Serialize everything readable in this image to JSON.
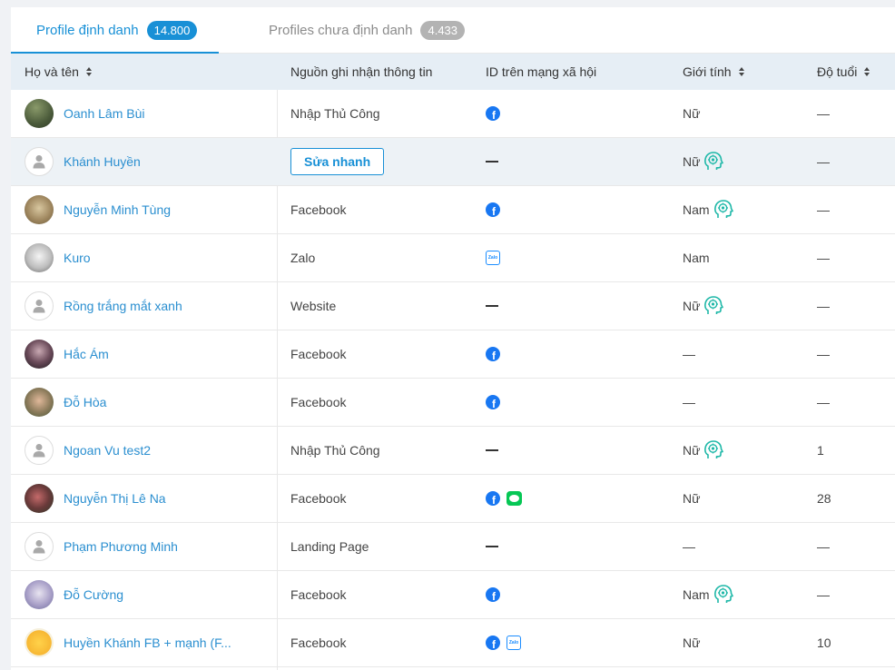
{
  "tabs": {
    "identified": {
      "label": "Profile định danh",
      "count": "14.800"
    },
    "unidentified": {
      "label": "Profiles chưa định danh",
      "count": "4.433"
    }
  },
  "columns": {
    "name": "Họ và tên",
    "source": "Nguồn ghi nhận thông tin",
    "social_id": "ID trên mạng xã hội",
    "gender": "Giới tính",
    "age": "Độ tuổi"
  },
  "actions": {
    "quick_edit": "Sửa nhanh"
  },
  "colors": {
    "accent": "#1890d6",
    "ai_icon": "#1fb8a8",
    "facebook": "#1877f2",
    "zalo": "#1a8cff",
    "line": "#06c755"
  },
  "rows": [
    {
      "name": "Oanh Lâm Bùi",
      "avatar": "photo-forest",
      "source": "Nhập Thủ Công",
      "social": [
        "facebook"
      ],
      "gender": "Nữ",
      "gender_ai": false,
      "age": "—"
    },
    {
      "name": "Khánh Huyền",
      "avatar": "default-user",
      "source": "",
      "quick_edit": true,
      "social": [],
      "gender": "Nữ",
      "gender_ai": true,
      "age": "—"
    },
    {
      "name": "Nguyễn Minh Tùng",
      "avatar": "photo-cat",
      "source": "Facebook",
      "social": [
        "facebook"
      ],
      "gender": "Nam",
      "gender_ai": true,
      "age": "—"
    },
    {
      "name": "Kuro",
      "avatar": "photo-sketch",
      "source": "Zalo",
      "social": [
        "zalo"
      ],
      "gender": "Nam",
      "gender_ai": false,
      "age": "—"
    },
    {
      "name": "Rồng trắng mắt xanh",
      "avatar": "default-user",
      "source": "Website",
      "social": [],
      "gender": "Nữ",
      "gender_ai": true,
      "age": "—"
    },
    {
      "name": "Hắc Ám",
      "avatar": "photo-dark",
      "source": "Facebook",
      "social": [
        "facebook"
      ],
      "gender": "—",
      "gender_ai": false,
      "age": "—"
    },
    {
      "name": "Đỗ Hòa",
      "avatar": "photo-child",
      "source": "Facebook",
      "social": [
        "facebook"
      ],
      "gender": "—",
      "gender_ai": false,
      "age": "—"
    },
    {
      "name": "Ngoan Vu test2",
      "avatar": "default-user",
      "source": "Nhập Thủ Công",
      "social": [],
      "gender": "Nữ",
      "gender_ai": true,
      "age": "1"
    },
    {
      "name": "Nguyễn Thị Lê Na",
      "avatar": "photo-flowers",
      "source": "Facebook",
      "social": [
        "facebook",
        "line"
      ],
      "gender": "Nữ",
      "gender_ai": false,
      "age": "28"
    },
    {
      "name": "Phạm Phương Minh",
      "avatar": "default-user",
      "source": "Landing Page",
      "social": [],
      "gender": "—",
      "gender_ai": false,
      "age": "—"
    },
    {
      "name": "Đỗ Cường",
      "avatar": "photo-anime",
      "source": "Facebook",
      "social": [
        "facebook"
      ],
      "gender": "Nam",
      "gender_ai": true,
      "age": "—"
    },
    {
      "name": "Huyền Khánh FB + mạnh (F...",
      "avatar": "photo-emoji",
      "source": "Facebook",
      "social": [
        "facebook",
        "zalo"
      ],
      "gender": "Nữ",
      "gender_ai": false,
      "age": "10"
    }
  ]
}
